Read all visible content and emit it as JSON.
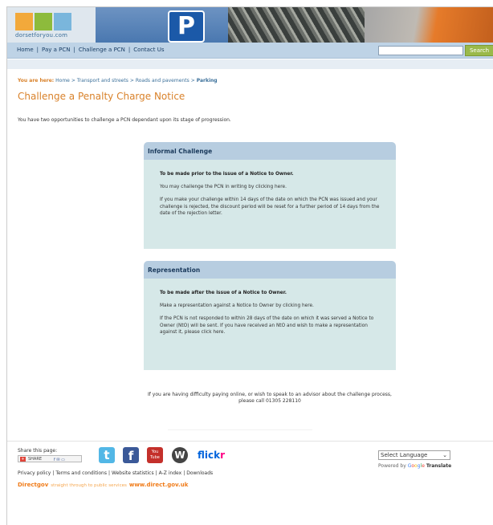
{
  "header": {
    "logo_text": "dorsetforyou.com",
    "parking_sign": "P"
  },
  "nav": {
    "items": [
      "Home",
      "Pay a PCN",
      "Challenge a PCN",
      "Contact Us"
    ],
    "search_placeholder": "",
    "search_button": "Search"
  },
  "breadcrumb": {
    "label": "You are here:",
    "items": [
      "Home",
      "Transport and streets",
      "Roads and pavements",
      "Parking"
    ],
    "separator": ">"
  },
  "page": {
    "title": "Challenge a Penalty Charge Notice",
    "intro": "You have two opportunities to challenge a PCN dependant upon its stage of progression."
  },
  "panels": [
    {
      "heading": "Informal Challenge",
      "lead": "To be made prior to the issue of a Notice to Owner.",
      "paragraphs": [
        "You may challenge the PCN in writing by clicking here.",
        "If you make your challenge within 14 days of the date on which the PCN was issued and your challenge is rejected, the discount period will be reset for a further period of 14 days from the date of the rejection letter."
      ]
    },
    {
      "heading": "Representation",
      "lead": "To be made after the issue of a Notice to Owner.",
      "paragraphs": [
        "Make a representation against a Notice to Owner by clicking here.",
        "If the PCN is not responded to within 28 days of the date on which it was served a Notice to Owner (NtO) will be sent. If you have received an NtO and wish to make a representation against it, please click here."
      ]
    }
  ],
  "contact": {
    "line1": "If you are having difficulty paying online, or wish to speak to an advisor about the challenge process,",
    "line2": "please call 01305 228110"
  },
  "footer": {
    "share_label": "Share this page:",
    "share_button": "SHARE",
    "social": {
      "twitter": "t",
      "facebook": "f",
      "youtube_top": "You",
      "youtube_bottom": "Tube",
      "wordpress": "W",
      "flickr_a": "flick",
      "flickr_b": "r"
    },
    "links": [
      "Privacy policy",
      "Terms and conditions",
      "Website statistics",
      "A-Z index",
      "Downloads"
    ],
    "directgov_brand": "Directgov",
    "directgov_tagline": "straight through to public services",
    "directgov_url": "www.direct.gov.uk",
    "language_select": "Select Language",
    "powered_by": "Powered by",
    "google_g": "G",
    "google_o1": "o",
    "google_o2": "o",
    "google_g2": "g",
    "google_l": "l",
    "google_e": "e",
    "translate": "Translate"
  },
  "colors": {
    "accent_orange": "#d9822b",
    "nav_bg": "#bed3e6",
    "panel_header": "#b7cde0",
    "panel_body": "#d6e8e8",
    "search_green": "#9ab94a"
  }
}
